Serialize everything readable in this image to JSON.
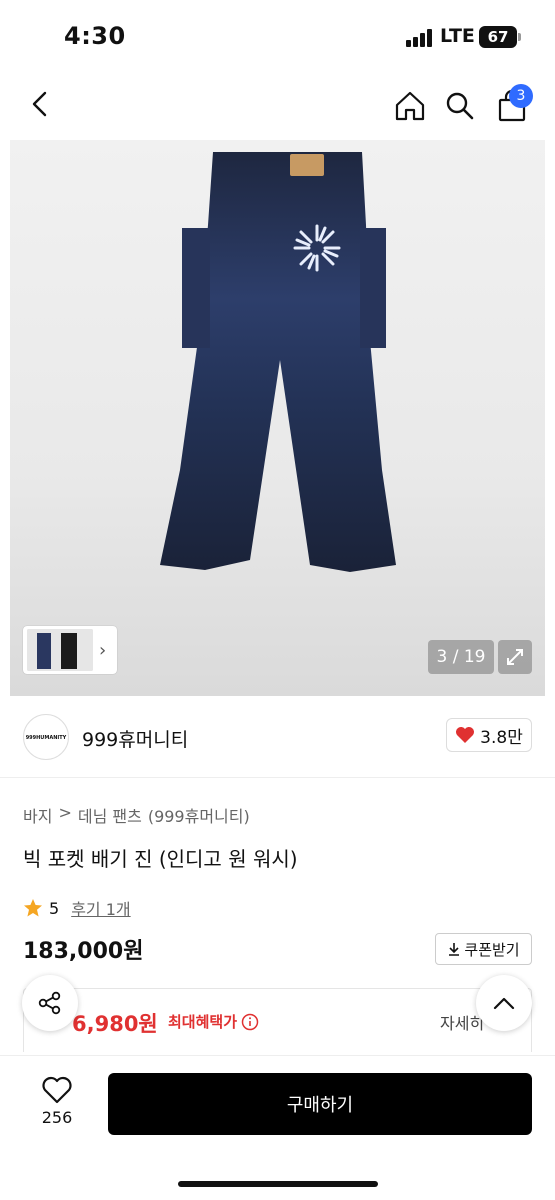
{
  "status": {
    "time": "4:30",
    "network": "LTE",
    "battery": "67"
  },
  "header": {
    "cart_count": "3"
  },
  "gallery": {
    "counter": "3 / 19"
  },
  "seller": {
    "logo_text": "999HUMANITY",
    "name": "999휴머니티",
    "likes": "3.8만"
  },
  "breadcrumb": [
    "바지",
    ">",
    "데님 팬츠",
    "(999휴머니티)"
  ],
  "product": {
    "title": "빅 포켓 배기 진 (인디고 원 워시)",
    "rating": "5",
    "review_link": "후기 1개",
    "price": "183,000원",
    "coupon_label": "쿠폰받기"
  },
  "benefit": {
    "price": "6,980원",
    "label": "최대혜택가",
    "detail_label": "자세히"
  },
  "footer": {
    "wish_count": "256",
    "buy_label": "구매하기"
  },
  "colors": {
    "accent": "#2f6bff",
    "sale": "#e03131",
    "buy_button": "#000000"
  }
}
